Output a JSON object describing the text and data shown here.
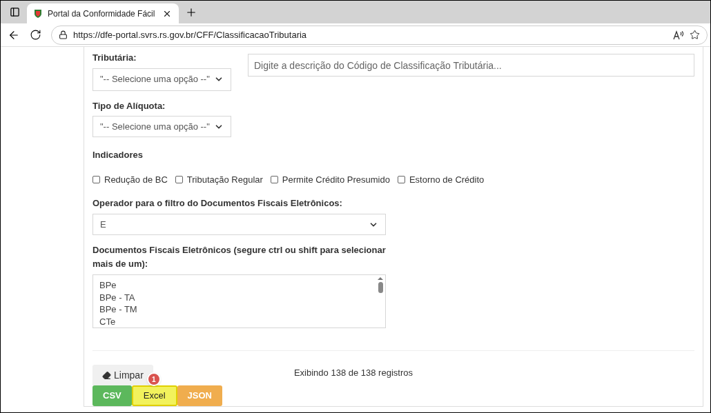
{
  "browser": {
    "tab_title": "Portal da Conformidade Fácil",
    "url": "https://dfe-portal.svrs.rs.gov.br/CFF/ClassificacaoTributaria"
  },
  "filters": {
    "tributaria": {
      "label": "Tributária:",
      "value": "\"-- Selecione uma opção --\""
    },
    "descricao": {
      "placeholder": "Digite a descrição do Código de Classificação Tributária..."
    },
    "aliquota": {
      "label": "Tipo de Alíquota:",
      "value": "\"-- Selecione uma opção --\""
    },
    "indicadores": {
      "label": "Indicadores",
      "items": [
        {
          "label": "Redução de BC",
          "checked": false
        },
        {
          "label": "Tributação Regular",
          "checked": false
        },
        {
          "label": "Permite Crédito Presumido",
          "checked": false
        },
        {
          "label": "Estorno de Crédito",
          "checked": false
        }
      ]
    },
    "operador": {
      "label": "Operador para o filtro do Documentos Fiscais Eletrônicos:",
      "value": "E"
    },
    "documentos": {
      "label": "Documentos Fiscais Eletrônicos (segure ctrl ou shift para selecionar mais de um):",
      "options": [
        {
          "label": "BPe",
          "selected": false
        },
        {
          "label": "BPe - TA",
          "selected": false
        },
        {
          "label": "BPe - TM",
          "selected": false
        },
        {
          "label": "CTe",
          "selected": false
        }
      ]
    }
  },
  "actions": {
    "clear": "Limpar",
    "record_count": "Exibindo 138 de 138 registros",
    "exports": [
      {
        "label": "CSV",
        "kind": "csv",
        "highlighted": false
      },
      {
        "label": "Excel",
        "kind": "excel",
        "highlighted": true,
        "badge": "1"
      },
      {
        "label": "JSON",
        "kind": "json",
        "highlighted": false
      }
    ]
  }
}
